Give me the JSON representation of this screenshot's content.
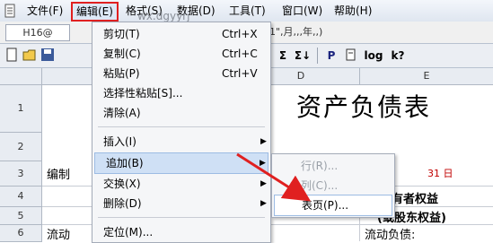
{
  "menubar": {
    "items": [
      {
        "label": "文件(F)"
      },
      {
        "label": "编辑(E)"
      },
      {
        "label": "格式(S)"
      },
      {
        "label": "数据(D)"
      },
      {
        "label": "工具(T)"
      },
      {
        "label": "窗口(W)"
      },
      {
        "label": "帮助(H)"
      }
    ]
  },
  "watermark": "wx.dgyyrj",
  "formula_bar": {
    "cell_ref": "H16@",
    "formula": "1\",月,,,年,,)"
  },
  "toolbar": {
    "buttons": [
      "new-icon",
      "open-icon",
      "save-icon",
      "sum-icon",
      "sort-icon",
      "p-icon",
      "prop-icon",
      "log-icon",
      "help-icon"
    ],
    "labels": {
      "sigma1": "Σ",
      "sigma2": "Σ↓",
      "p": "P",
      "log": "log",
      "help": "k?"
    }
  },
  "sheet": {
    "col_headers": [
      "D",
      "E"
    ],
    "row_headers": [
      "1",
      "2",
      "3",
      "4",
      "5",
      "6"
    ],
    "title": "资产负债表",
    "cells": {
      "b3": "编制",
      "e3_date": "31 日",
      "e4": "和所有者权益",
      "e5": "(或股东权益)",
      "b6": "流动",
      "e6": "流动负债:"
    }
  },
  "edit_menu": {
    "items": [
      {
        "label": "剪切(T)",
        "shortcut": "Ctrl+X"
      },
      {
        "label": "复制(C)",
        "shortcut": "Ctrl+C"
      },
      {
        "label": "粘贴(P)",
        "shortcut": "Ctrl+V"
      },
      {
        "label": "选择性粘贴[S]..."
      },
      {
        "label": "清除(A)"
      },
      {
        "label": "插入(I)",
        "submenu": "▶"
      },
      {
        "label": "追加(B)",
        "submenu": "▶"
      },
      {
        "label": "交换(X)",
        "submenu": "▶"
      },
      {
        "label": "删除(D)",
        "submenu": "▶"
      },
      {
        "label": "定位(M)..."
      }
    ]
  },
  "submenu": {
    "items": [
      {
        "label": "行(R)..."
      },
      {
        "label": "列(C)..."
      },
      {
        "label": "表页(P)..."
      }
    ]
  },
  "colors": {
    "highlight_box": "#e02020",
    "arrow": "#e02020",
    "menu_bg": "#f5f6f8",
    "selected_bg": "#cfe0f5"
  }
}
